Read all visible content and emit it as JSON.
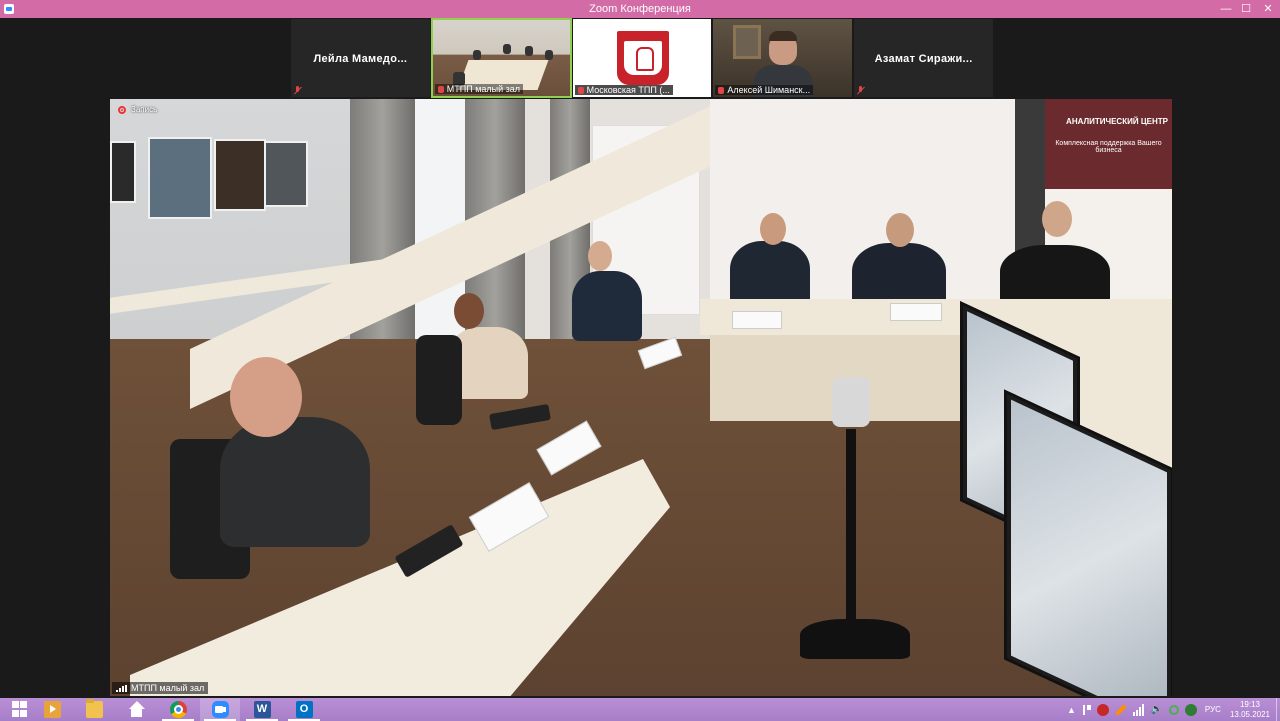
{
  "window": {
    "title": "Zoom Конференция",
    "controls": {
      "minimize": "—",
      "maximize": "☐",
      "close": "✕"
    }
  },
  "participants": [
    {
      "name": "Лейла Мамедо...",
      "type": "name"
    },
    {
      "caption": "МТПП малый зал",
      "type": "video",
      "active": true
    },
    {
      "caption": "Московская ТПП (...",
      "type": "logo"
    },
    {
      "caption": "Алексей Шиманск...",
      "type": "camera"
    },
    {
      "name": "Азамат Сиражи...",
      "type": "name"
    }
  ],
  "main_video": {
    "recording_label": "Запись",
    "caption": "МТПП малый зал",
    "banner_text": "АНАЛИТИЧЕСКИЙ ЦЕНТР",
    "banner_sub": "Комплексная поддержка Вашего бизнеса"
  },
  "taskbar": {
    "apps": [
      "start",
      "media-player",
      "file-explorer",
      "home",
      "chrome",
      "zoom",
      "word",
      "outlook"
    ],
    "word_letter": "W",
    "outlook_letter": "O",
    "language": "РУС",
    "time": "19:13",
    "date": "13.05.2021"
  }
}
